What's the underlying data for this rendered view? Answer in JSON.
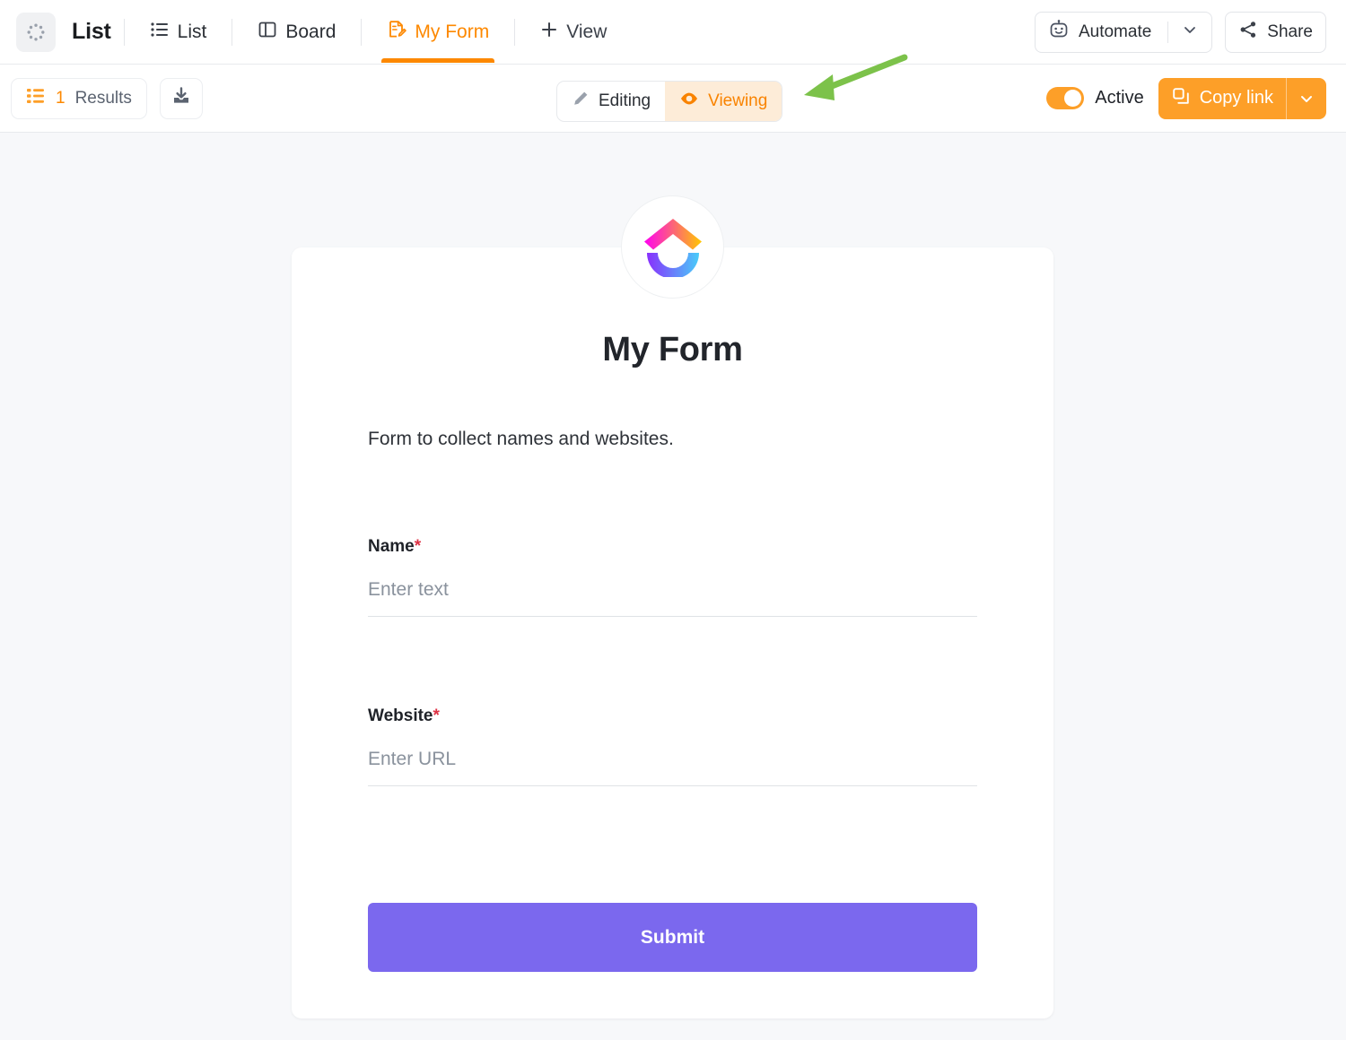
{
  "header": {
    "list_badge_icon": "dotted-circle-icon",
    "page_title": "List",
    "tabs": [
      {
        "label": "List",
        "icon": "list-icon",
        "active": false
      },
      {
        "label": "Board",
        "icon": "board-icon",
        "active": false
      },
      {
        "label": "My Form",
        "icon": "form-icon",
        "active": true
      },
      {
        "label": "View",
        "icon": "plus-icon",
        "active": false
      }
    ],
    "automate": {
      "label": "Automate",
      "icon": "robot-icon",
      "caret": "chevron-down-icon"
    },
    "share": {
      "label": "Share",
      "icon": "share-icon"
    }
  },
  "subbar": {
    "results": {
      "count": "1",
      "label": "Results",
      "icon": "list-orange-icon"
    },
    "export": {
      "icon": "download-icon"
    },
    "mode": {
      "editing": {
        "label": "Editing",
        "icon": "pencil-icon",
        "active": false
      },
      "viewing": {
        "label": "Viewing",
        "icon": "eye-icon",
        "active": true
      }
    },
    "active_toggle": {
      "label": "Active",
      "state": "on"
    },
    "copy_link": {
      "label": "Copy link",
      "icon": "copy-icon",
      "caret": "chevron-down-icon"
    }
  },
  "form": {
    "logo": "clickup-logo",
    "title": "My Form",
    "description": "Form to collect names and websites.",
    "fields": [
      {
        "label": "Name",
        "required": "*",
        "placeholder": "Enter text"
      },
      {
        "label": "Website",
        "required": "*",
        "placeholder": "Enter URL"
      }
    ],
    "submit_label": "Submit"
  },
  "annotation": {
    "arrow": "green-arrow-pointing-to-viewing"
  },
  "colors": {
    "accent_orange": "#fd8800",
    "orange_button": "#fd9f28",
    "viewing_bg": "#fdecd8",
    "submit_purple": "#7b68ee",
    "required_red": "#dd3144",
    "annotation_green": "#7cc24a",
    "page_bg": "#f7f8fa"
  }
}
